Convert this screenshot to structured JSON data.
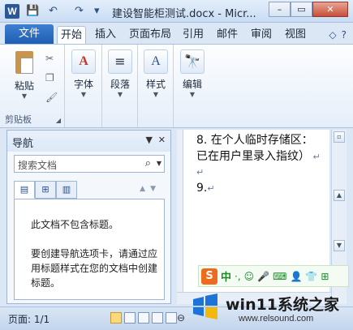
{
  "window": {
    "title": "建设智能柜测试.docx - Micr...",
    "logo_letter": "W",
    "controls": {
      "minimize": "–",
      "maximize": "▭",
      "close": "✕"
    }
  },
  "quick_access": {
    "save": "💾",
    "undo": "↶",
    "redo": "↷",
    "customize": "▾"
  },
  "tabs": [
    {
      "label": "文件"
    },
    {
      "label": "开始"
    },
    {
      "label": "插入"
    },
    {
      "label": "页面布局"
    },
    {
      "label": "引用"
    },
    {
      "label": "邮件"
    },
    {
      "label": "审阅"
    },
    {
      "label": "视图"
    }
  ],
  "tab_icons": {
    "collapse": "◇",
    "help": "?"
  },
  "ribbon": {
    "clipboard": {
      "paste_label": "粘贴",
      "group_label": "剪贴板"
    },
    "font": {
      "label": "字体",
      "icon_glyph": "A"
    },
    "paragraph": {
      "label": "段落",
      "icon_glyph": "≡"
    },
    "styles": {
      "label": "样式",
      "icon_glyph": "A"
    },
    "editing": {
      "label": "编辑",
      "icon_glyph": "🔭"
    }
  },
  "nav_pane": {
    "title": "导航",
    "search_placeholder": "搜索文档",
    "tab_glyphs": [
      "▤",
      "⊞",
      "▥"
    ],
    "arrows": "▲▼",
    "message_1": "此文档不包含标题。",
    "message_2": "要创建导航选项卡，请通过应用标题样式在您的文档中创建标题。"
  },
  "document": {
    "line1": "8. 在个人临时存储区：",
    "line2": "已在用户里录入指纹）",
    "line4": "9."
  },
  "ime_bar": {
    "logo": "S",
    "lang": "中",
    "items": [
      "·,",
      "☺",
      "🎤",
      "⌨",
      "👤",
      "👕",
      "⊞"
    ]
  },
  "status": {
    "page": "页面: 1/1"
  },
  "watermark": {
    "brand": "win11系统之家",
    "url": "www.relsound.com"
  },
  "colors": {
    "accent": "#1f5fb3",
    "ribbon_bg": "#e5eef9",
    "ime_green": "#1a8a2a",
    "ime_orange": "#f06a1e"
  }
}
